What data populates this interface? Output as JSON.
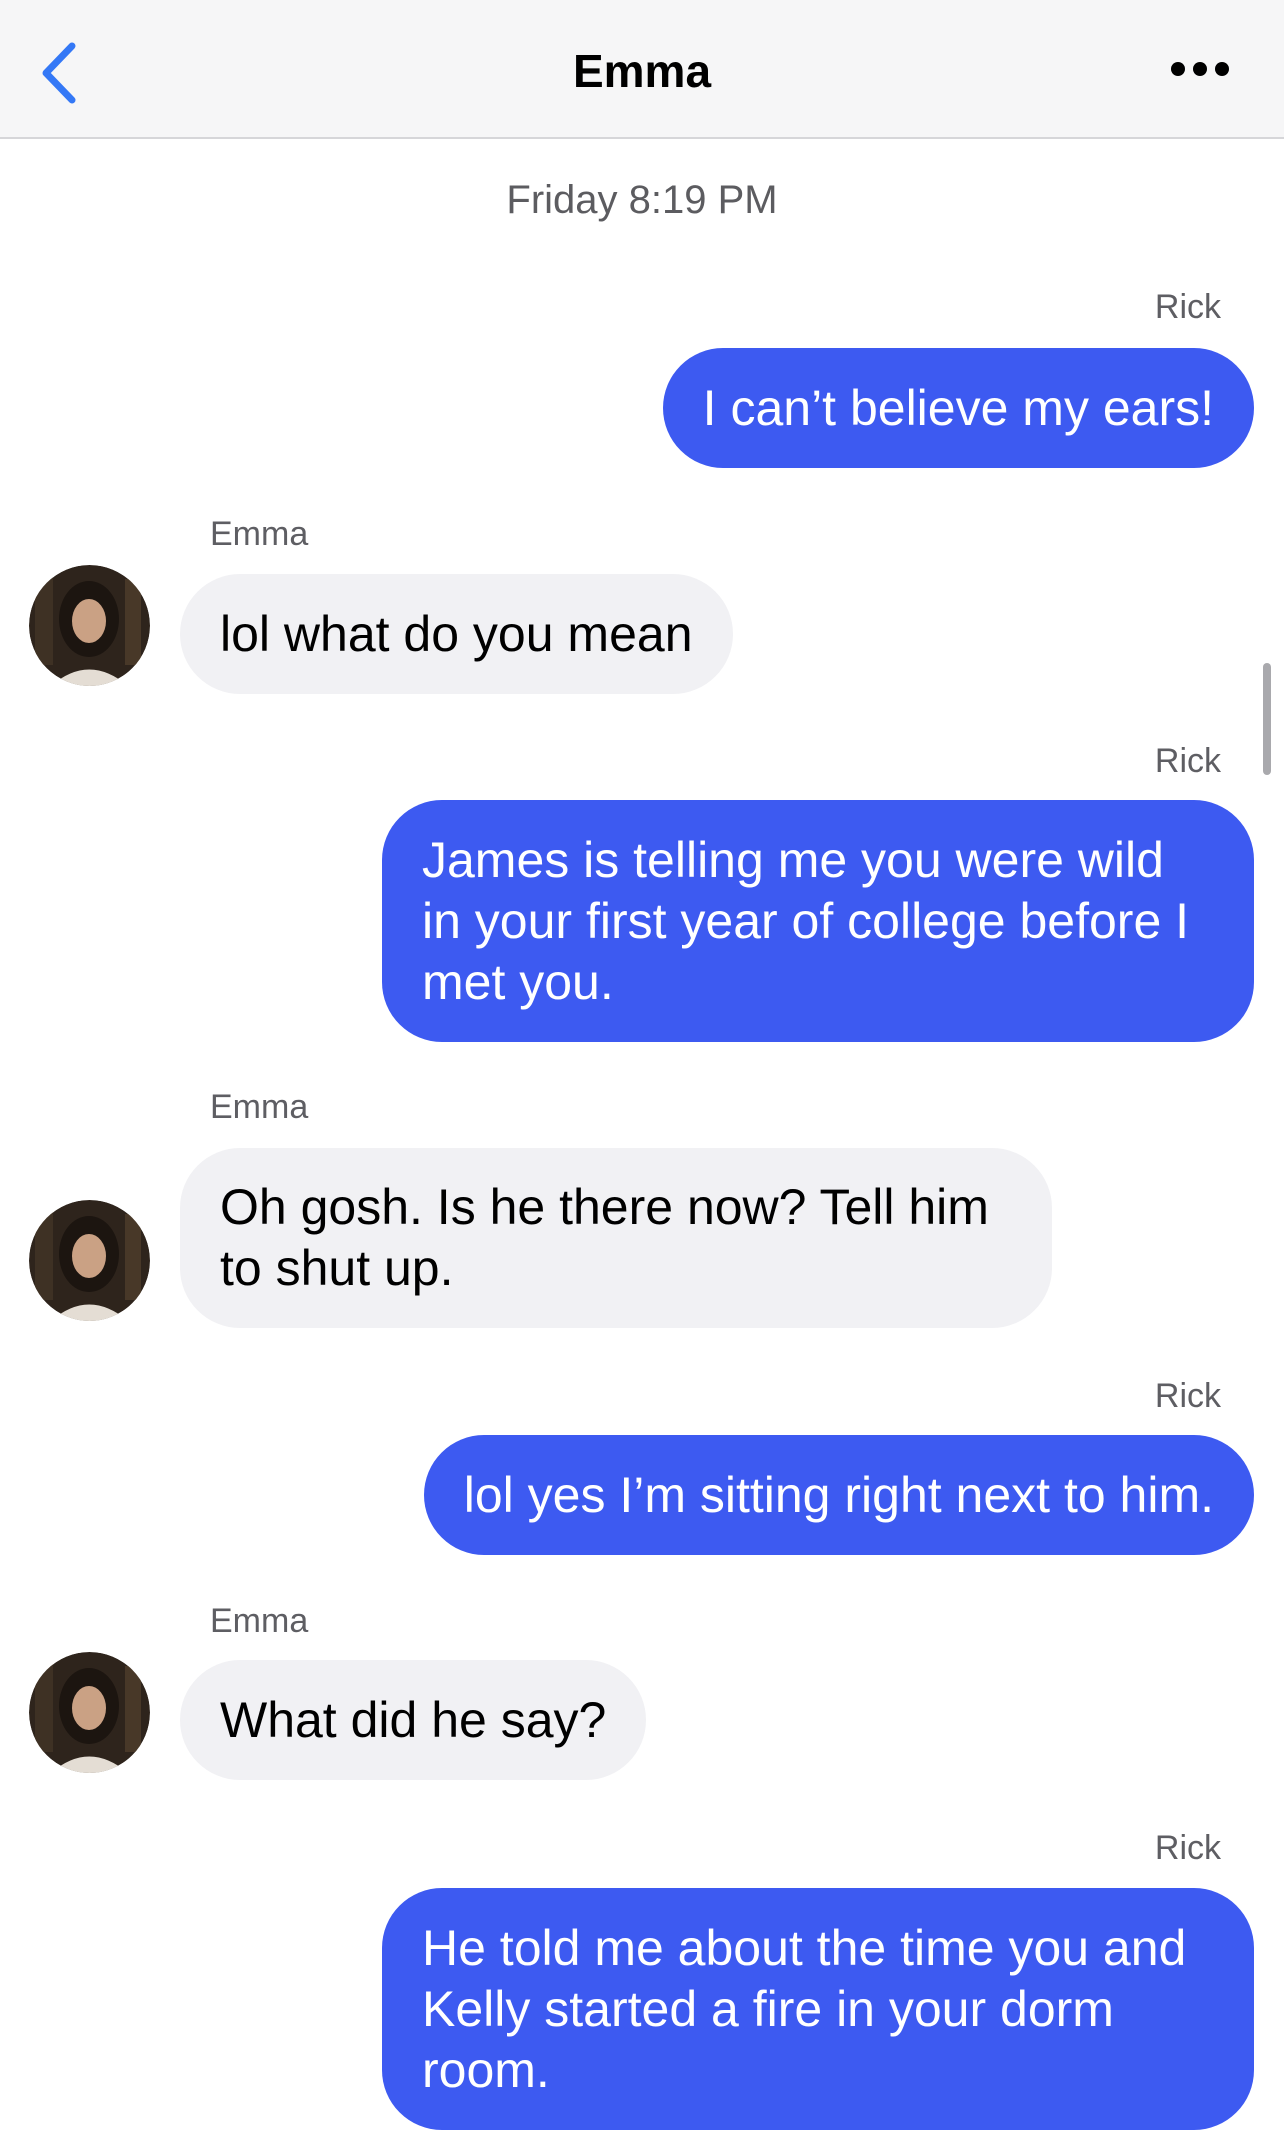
{
  "header": {
    "title": "Emma",
    "back_icon": "chevron-left-icon",
    "more_icon": "more-horizontal-icon",
    "accent_color": "#3478f6"
  },
  "conversation": {
    "timestamp": "Friday 8:19 PM",
    "messages": [
      {
        "sender": "Rick",
        "direction": "outgoing",
        "text": "I can’t believe my ears!"
      },
      {
        "sender": "Emma",
        "direction": "incoming",
        "text": "lol what do you mean"
      },
      {
        "sender": "Rick",
        "direction": "outgoing",
        "text": "James is telling me you were wild in your first year of college before I met you."
      },
      {
        "sender": "Emma",
        "direction": "incoming",
        "text": "Oh gosh. Is he there now? Tell him to shut up."
      },
      {
        "sender": "Rick",
        "direction": "outgoing",
        "text": "lol yes I’m sitting right next to him."
      },
      {
        "sender": "Emma",
        "direction": "incoming",
        "text": "What did he say?"
      },
      {
        "sender": "Rick",
        "direction": "outgoing",
        "text": "He told me about the time you and Kelly started a fire in your dorm room."
      }
    ]
  },
  "colors": {
    "outgoing_bubble": "#3d5af1",
    "incoming_bubble": "#f1f1f4"
  }
}
